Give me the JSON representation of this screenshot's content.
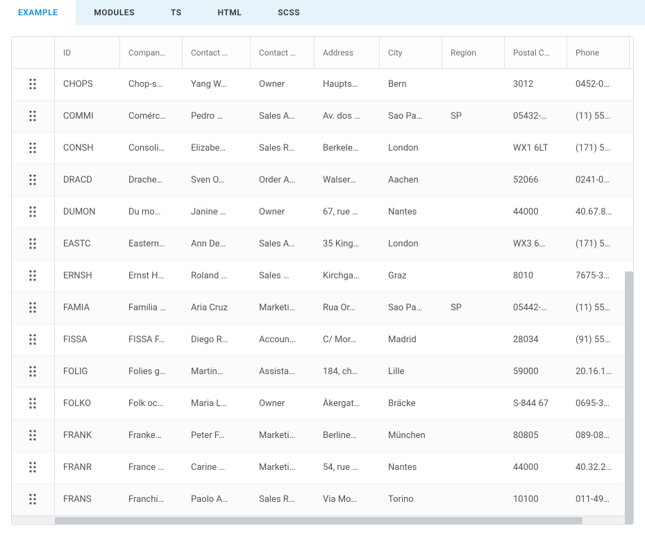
{
  "tabs": [
    {
      "label": "EXAMPLE",
      "active": true
    },
    {
      "label": "MODULES",
      "active": false
    },
    {
      "label": "TS",
      "active": false
    },
    {
      "label": "HTML",
      "active": false
    },
    {
      "label": "SCSS",
      "active": false
    }
  ],
  "columns": {
    "drag": "",
    "id": "ID",
    "company": "Compan…",
    "contactName": "Contact …",
    "contactTitle": "Contact …",
    "address": "Address",
    "city": "City",
    "region": "Region",
    "postal": "Postal C…",
    "phone": "Phone"
  },
  "rows": [
    {
      "id": "CHOPS",
      "company": "Chop-s…",
      "contactName": "Yang W…",
      "contactTitle": "Owner",
      "address": "Haupts…",
      "city": "Bern",
      "region": "",
      "postal": "3012",
      "phone": "0452-0…"
    },
    {
      "id": "COMMI",
      "company": "Comérc…",
      "contactName": "Pedro …",
      "contactTitle": "Sales A…",
      "address": "Av. dos …",
      "city": "Sao Pa…",
      "region": "SP",
      "postal": "05432-…",
      "phone": "(11) 55…"
    },
    {
      "id": "CONSH",
      "company": "Consoli…",
      "contactName": "Elizabe…",
      "contactTitle": "Sales R…",
      "address": "Berkele…",
      "city": "London",
      "region": "",
      "postal": "WX1 6LT",
      "phone": "(171) 5…"
    },
    {
      "id": "DRACD",
      "company": "Drache…",
      "contactName": "Sven O…",
      "contactTitle": "Order A…",
      "address": "Walser…",
      "city": "Aachen",
      "region": "",
      "postal": "52066",
      "phone": "0241-0…"
    },
    {
      "id": "DUMON",
      "company": "Du mo…",
      "contactName": "Janine …",
      "contactTitle": "Owner",
      "address": "67, rue …",
      "city": "Nantes",
      "region": "",
      "postal": "44000",
      "phone": "40.67.8…"
    },
    {
      "id": "EASTC",
      "company": "Eastern…",
      "contactName": "Ann De…",
      "contactTitle": "Sales A…",
      "address": "35 King…",
      "city": "London",
      "region": "",
      "postal": "WX3 6…",
      "phone": "(171) 5…"
    },
    {
      "id": "ERNSH",
      "company": "Ernst H…",
      "contactName": "Roland …",
      "contactTitle": "Sales …",
      "address": "Kirchga…",
      "city": "Graz",
      "region": "",
      "postal": "8010",
      "phone": "7675-3…"
    },
    {
      "id": "FAMIA",
      "company": "Familia …",
      "contactName": "Aria Cruz",
      "contactTitle": "Marketi…",
      "address": "Rua Or…",
      "city": "Sao Pa…",
      "region": "SP",
      "postal": "05442-…",
      "phone": "(11) 55…"
    },
    {
      "id": "FISSA",
      "company": "FISSA F…",
      "contactName": "Diego R…",
      "contactTitle": "Accoun…",
      "address": "C/ Mor…",
      "city": "Madrid",
      "region": "",
      "postal": "28034",
      "phone": "(91) 55…"
    },
    {
      "id": "FOLIG",
      "company": "Folies g…",
      "contactName": "Martin…",
      "contactTitle": "Assista…",
      "address": "184, ch…",
      "city": "Lille",
      "region": "",
      "postal": "59000",
      "phone": "20.16.1…"
    },
    {
      "id": "FOLKO",
      "company": "Folk oc…",
      "contactName": "Maria L…",
      "contactTitle": "Owner",
      "address": "Åkergat…",
      "city": "Bräcke",
      "region": "",
      "postal": "S-844 67",
      "phone": "0695-3…"
    },
    {
      "id": "FRANK",
      "company": "Franke…",
      "contactName": "Peter F…",
      "contactTitle": "Marketi…",
      "address": "Berline…",
      "city": "München",
      "region": "",
      "postal": "80805",
      "phone": "089-08…"
    },
    {
      "id": "FRANR",
      "company": "France …",
      "contactName": "Carine …",
      "contactTitle": "Marketi…",
      "address": "54, rue …",
      "city": "Nantes",
      "region": "",
      "postal": "44000",
      "phone": "40.32.2…"
    },
    {
      "id": "FRANS",
      "company": "Franchi…",
      "contactName": "Paolo A…",
      "contactTitle": "Sales R…",
      "address": "Via Mo…",
      "city": "Torino",
      "region": "",
      "postal": "10100",
      "phone": "011-49…"
    }
  ]
}
